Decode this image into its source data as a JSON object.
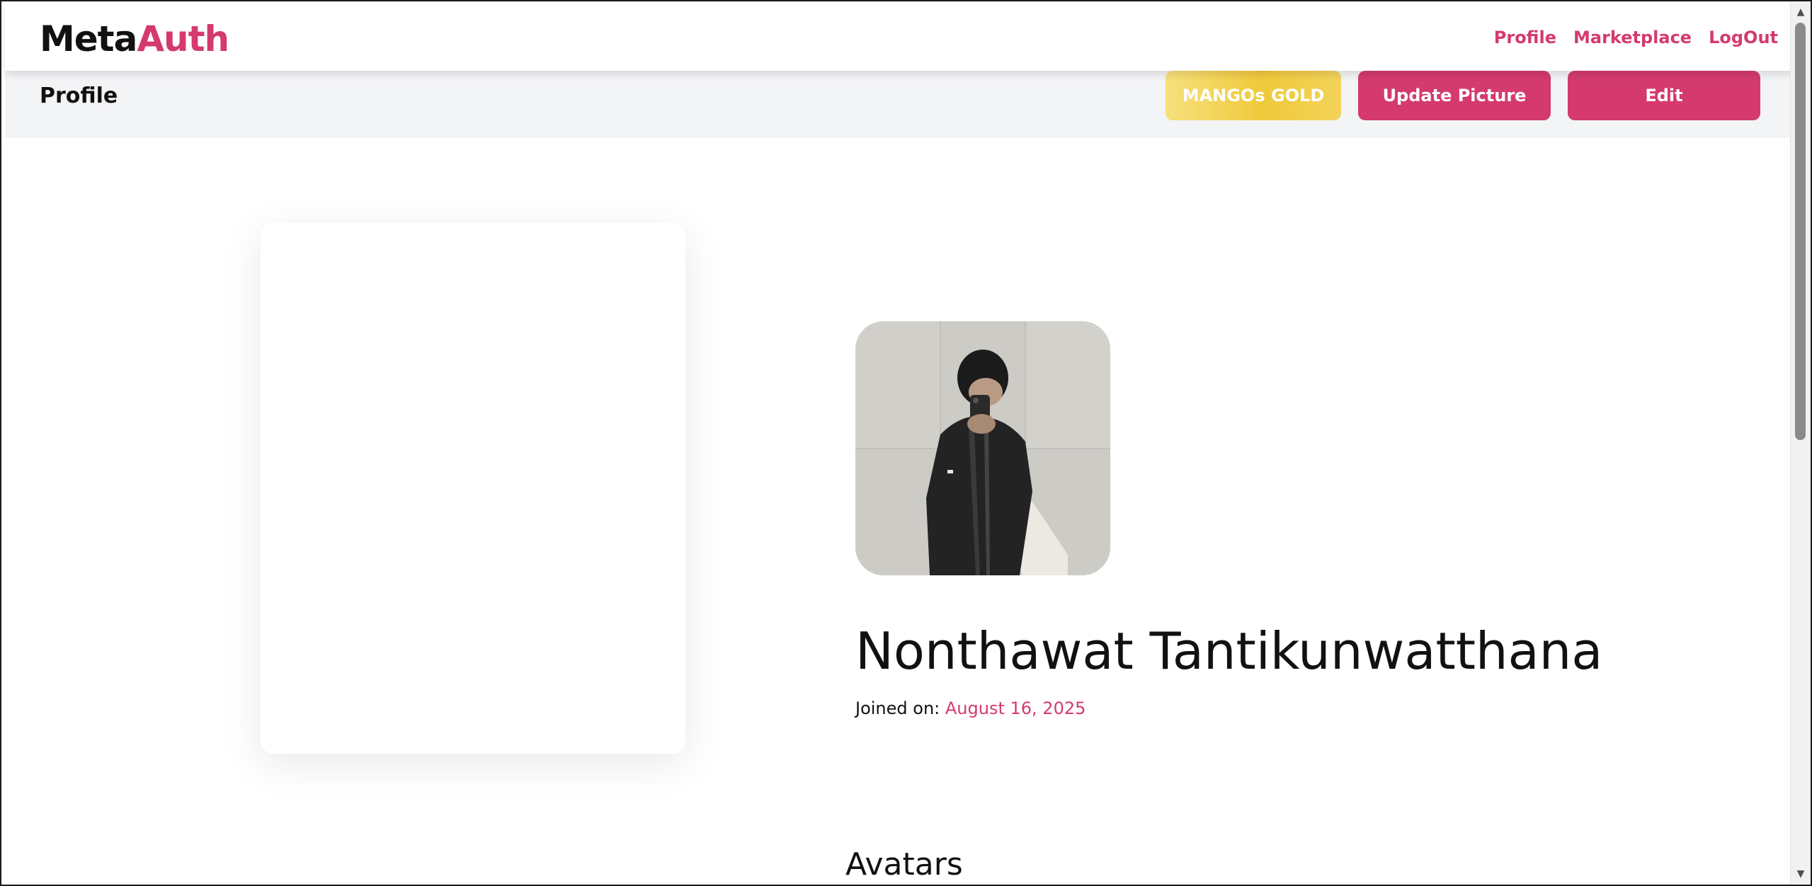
{
  "brand": {
    "part1": "Meta",
    "part2": "Auth"
  },
  "nav": {
    "profile": "Profile",
    "marketplace": "Marketplace",
    "logout": "LogOut"
  },
  "subheader": {
    "title": "Profile",
    "gold_button": "MANGOs GOLD",
    "update_button": "Update Picture",
    "edit_button": "Edit"
  },
  "profile": {
    "name": "Nonthawat Tantikunwatthana",
    "joined_label": "Joined on:",
    "joined_date": "August 16, 2025",
    "avatar_alt": "profile photo"
  },
  "sections": {
    "avatars_title": "Avatars"
  },
  "colors": {
    "accent": "#d43a6e",
    "gold_start": "#f7e07d",
    "gold_end": "#f0c93b",
    "subheader_bg": "#f3f4f6"
  },
  "icons": {
    "scroll_up": "triangle-up-icon",
    "scroll_down": "triangle-down-icon"
  }
}
